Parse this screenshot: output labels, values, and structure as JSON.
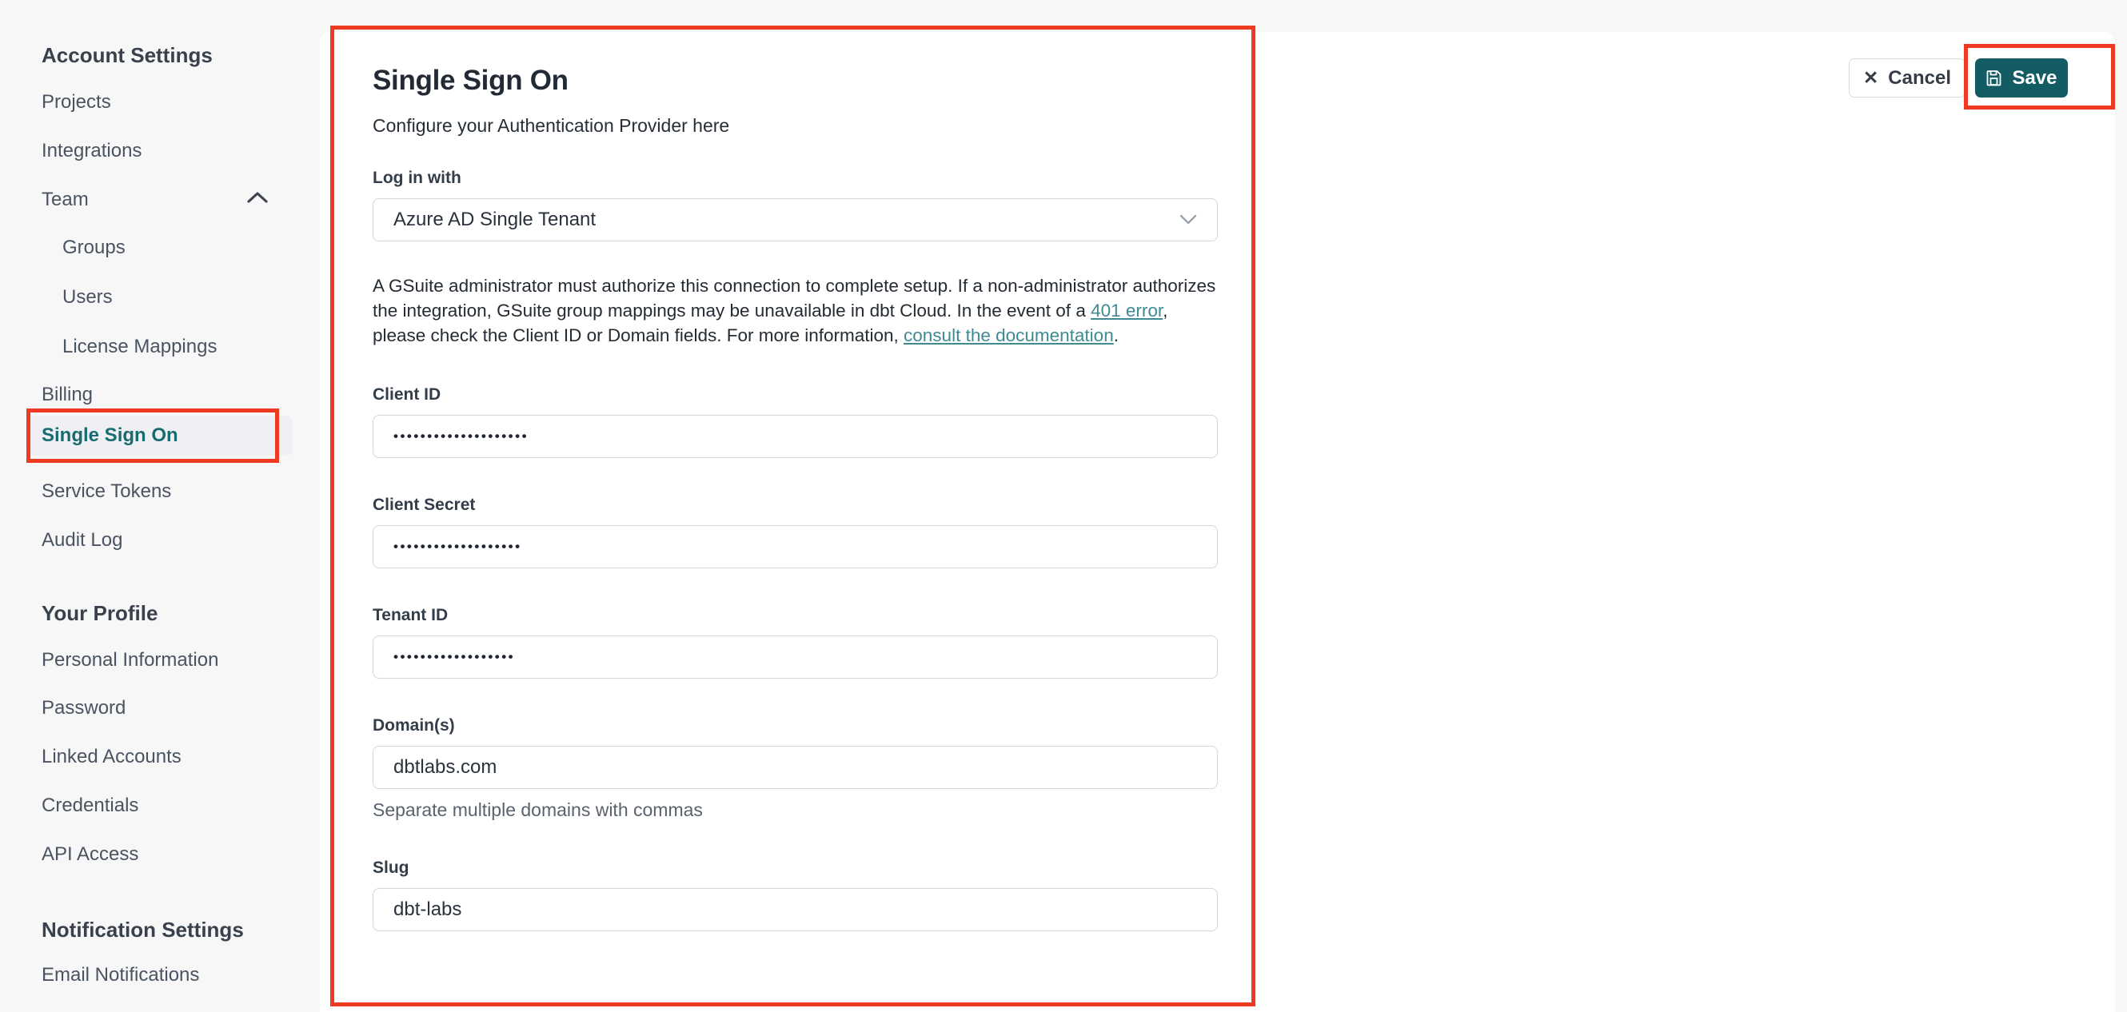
{
  "sidebar": {
    "sections": [
      {
        "header": "Account Settings",
        "items": [
          {
            "label": "Projects"
          },
          {
            "label": "Integrations"
          },
          {
            "label": "Team",
            "expanded": true
          },
          {
            "label": "Groups",
            "sub": true
          },
          {
            "label": "Users",
            "sub": true
          },
          {
            "label": "License Mappings",
            "sub": true
          },
          {
            "label": "Billing"
          },
          {
            "label": "Single Sign On",
            "selected": true
          },
          {
            "label": "Service Tokens"
          },
          {
            "label": "Audit Log"
          }
        ]
      },
      {
        "header": "Your Profile",
        "items": [
          {
            "label": "Personal Information"
          },
          {
            "label": "Password"
          },
          {
            "label": "Linked Accounts"
          },
          {
            "label": "Credentials"
          },
          {
            "label": "API Access"
          }
        ]
      },
      {
        "header": "Notification Settings",
        "items": [
          {
            "label": "Email Notifications"
          }
        ]
      }
    ]
  },
  "main": {
    "title": "Single Sign On",
    "subtitle": "Configure your Authentication Provider here",
    "login_with": {
      "label": "Log in with",
      "value": "Azure AD Single Tenant"
    },
    "note": {
      "p1": "A GSuite administrator must authorize this connection to complete setup. If a non-administrator authorizes the integration, GSuite group mappings may be unavailable in dbt Cloud. In the event of a ",
      "link_401": "401 error",
      "p2": ", please check the Client ID or Domain fields. For more information, ",
      "link_docs": "consult the documentation",
      "p3": "."
    },
    "fields": {
      "client_id": {
        "label": "Client ID",
        "value": "••••••••••••••••••••"
      },
      "client_secret": {
        "label": "Client Secret",
        "value": "•••••••••••••••••••"
      },
      "tenant_id": {
        "label": "Tenant ID",
        "value": "••••••••••••••••••"
      },
      "domains": {
        "label": "Domain(s)",
        "value": "dbtlabs.com",
        "helper": "Separate multiple domains with commas"
      },
      "slug": {
        "label": "Slug",
        "value": "dbt-labs"
      }
    },
    "actions": {
      "cancel": "Cancel",
      "save": "Save"
    }
  },
  "colors": {
    "annotation_red": "#ee3a21",
    "save_button_teal": "#135c64",
    "selected_item_teal": "#1a6b70",
    "link_teal": "#3d8a93",
    "sidebar_background": "#f7f7f8"
  }
}
